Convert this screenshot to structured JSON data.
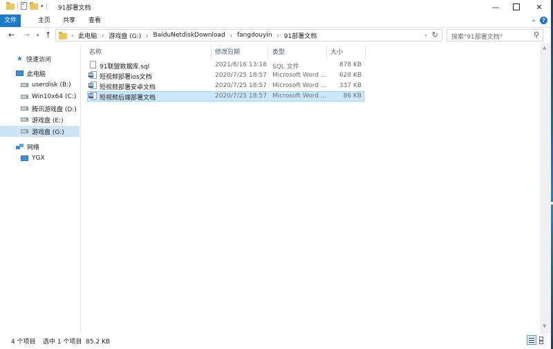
{
  "window": {
    "title": "91部署文档"
  },
  "ribbon": {
    "tabs": [
      "文件",
      "主页",
      "共享",
      "查看"
    ]
  },
  "address": {
    "crumbs": [
      "此电脑",
      "游戏盘 (G:)",
      "BaiduNetdiskDownload",
      "fangdouyin",
      "91部署文档"
    ]
  },
  "search": {
    "placeholder": "搜索\"91部署文档\""
  },
  "sidebar": {
    "items": [
      {
        "label": "快速访问",
        "icon": "star-icon"
      },
      {
        "label": "此电脑",
        "icon": "computer-icon"
      },
      {
        "label": "userdisk (B:)",
        "icon": "drive-icon"
      },
      {
        "label": "Win10x64 (C:)",
        "icon": "drive-icon"
      },
      {
        "label": "腾讯游戏盘 (D:)",
        "icon": "drive-icon"
      },
      {
        "label": "游戏盘 (E:)",
        "icon": "drive-icon"
      },
      {
        "label": "游戏盘 (G:)",
        "icon": "drive-icon",
        "selected": true
      },
      {
        "label": "网络",
        "icon": "network-icon"
      },
      {
        "label": "YGX",
        "icon": "monitor-icon"
      }
    ]
  },
  "columns": {
    "name": "名称",
    "modified": "修改日期",
    "type": "类型",
    "size": "大小"
  },
  "files": [
    {
      "name": "91联盟数据库.sql",
      "modified": "2021/8/16 13:18",
      "type": "SQL 文件",
      "size": "878 KB",
      "icon": "sql-file-icon"
    },
    {
      "name": "短视频部署ios文档",
      "modified": "2020/7/25 18:57",
      "type": "Microsoft Word ...",
      "size": "628 KB",
      "icon": "word-doc-icon"
    },
    {
      "name": "短视频部署安卓文档",
      "modified": "2020/7/25 18:57",
      "type": "Microsoft Word ...",
      "size": "337 KB",
      "icon": "word-doc-icon"
    },
    {
      "name": "短视频后端部署文档",
      "modified": "2020/7/25 18:57",
      "type": "Microsoft Word ...",
      "size": "86 KB",
      "icon": "word-doc-icon",
      "selected": true
    }
  ],
  "status": {
    "item_count": "4 个项目",
    "selection": "选中 1 个项目  85.2 KB"
  },
  "colors": {
    "accent": "#1979ca",
    "selection_bg": "#cce8ff",
    "selection_border": "#99d1ff",
    "sidebar_selected": "#cce4f7"
  }
}
